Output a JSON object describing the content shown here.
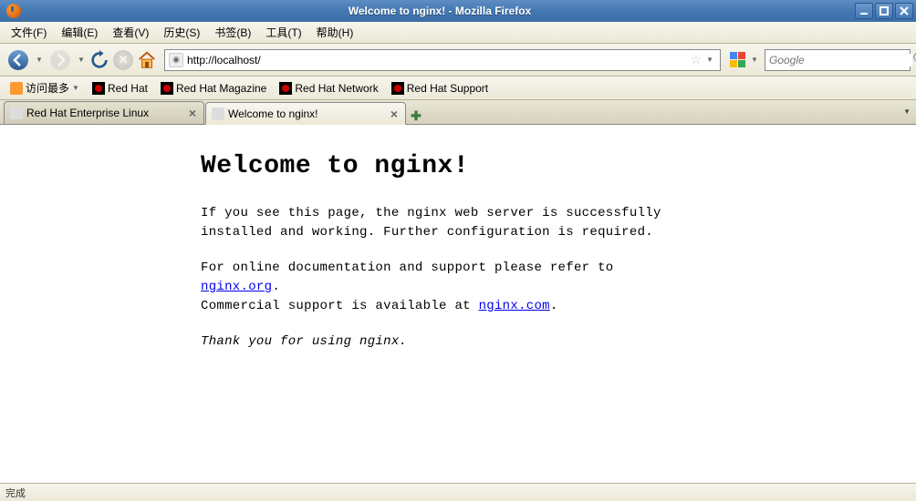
{
  "window": {
    "title": "Welcome to nginx! - Mozilla Firefox"
  },
  "menu": {
    "file": "文件(F)",
    "edit": "编辑(E)",
    "view": "查看(V)",
    "history": "历史(S)",
    "bookmarks": "书签(B)",
    "tools": "工具(T)",
    "help": "帮助(H)"
  },
  "urlbar": {
    "value": "http://localhost/"
  },
  "searchbar": {
    "placeholder": "Google"
  },
  "bookmarks": {
    "most_visited": "访问最多",
    "items": [
      "Red Hat",
      "Red Hat Magazine",
      "Red Hat Network",
      "Red Hat Support"
    ]
  },
  "tabs": [
    {
      "title": "Red Hat Enterprise Linux",
      "active": false
    },
    {
      "title": "Welcome to nginx!",
      "active": true
    }
  ],
  "page": {
    "heading": "Welcome to nginx!",
    "p1a": "If you see this page, the nginx web server is successfully installed and working. Further configuration is required.",
    "p2a": "For online documentation and support please refer to ",
    "link1": "nginx.org",
    "p2b": ".",
    "p2c": "Commercial support is available at ",
    "link2": "nginx.com",
    "p2d": ".",
    "p3": "Thank you for using nginx."
  },
  "status": {
    "text": "完成"
  }
}
